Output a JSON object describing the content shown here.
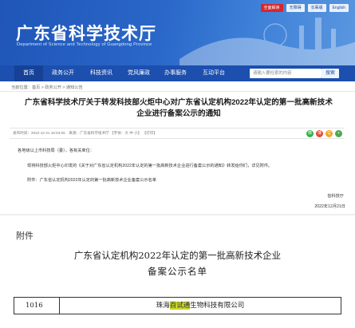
{
  "header": {
    "top_links": [
      "全面解读",
      "无障碍",
      "长辈版",
      "English"
    ],
    "site_title": "广东省科学技术厅",
    "site_subtitle": "Department of Science and Technology of Guangdong Province"
  },
  "nav": {
    "items": [
      "首页",
      "政务公开",
      "科技资讯",
      "党风廉政",
      "办事服务",
      "互动平台"
    ],
    "search_placeholder": "请输入要检索的内容",
    "search_button": "搜索"
  },
  "breadcrumb": "当前位置：首页 > 政务公开 > 通知公告",
  "article": {
    "title": "广东省科学技术厅关于转发科技部火炬中心对广东省认定机构2022年认定的第一批高新技术企业进行备案公示的通知",
    "meta": "发布时间：2022-12-21 16:53:55　来源：广东省科学技术厅 【字体：大 中 小】 【打印】",
    "salutation": "各地级以上市科技局（委），各有关单位：",
    "body": "现将科技部火炬中心印发的《关于对广东省认定机构2022年认定的第一批高新技术企业进行备案公示的通知》转发给你们，详见附件。",
    "attachment": "附件：广东省认定机构2022年认定的第一批高新技术企业备案公示名单",
    "signature": "省科技厅",
    "date": "2022年12月21日"
  },
  "document": {
    "attachment_label": "附件",
    "title_line1": "广东省认定机构2022年认定的第一批高新技术企业",
    "title_line2": "备案公示名单",
    "row": {
      "number": "1016",
      "company_prefix": "珠海",
      "company_highlight": "百试通",
      "company_suffix": "生物科技有限公司"
    }
  },
  "colors": {
    "banner": "#2a67c8",
    "nav": "#1c4fae",
    "highlight": "#c9d62b",
    "alert_red": "#d7262c"
  },
  "icons": [
    "wechat-icon",
    "weibo-icon",
    "qq-icon",
    "share-icon"
  ]
}
